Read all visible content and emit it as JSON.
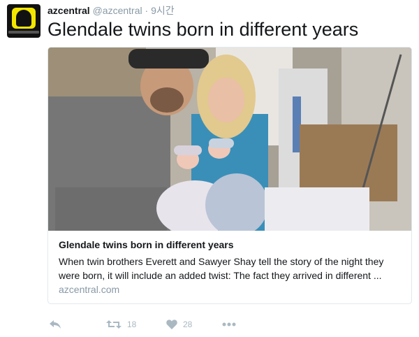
{
  "account": {
    "name": "azcentral",
    "handle": "@azcentral",
    "separator": "·",
    "time": "9시간",
    "avatar_icon": "snapchat-ghost-logo"
  },
  "tweet": {
    "text": "Glendale twins born in different years"
  },
  "card": {
    "image_alt": "Parents holding newborn twins in hospital",
    "title": "Glendale twins born in different years",
    "description": "When twin brothers  Everett and Sawyer Shay tell the story of the night they were born, it will include an added twist: The fact they arrived in different ...",
    "domain": "azcentral.com"
  },
  "actions": {
    "reply_icon": "reply-icon",
    "retweet_icon": "retweet-icon",
    "retweet_count": "18",
    "like_icon": "heart-icon",
    "like_count": "28",
    "more_icon": "more-icon"
  },
  "colors": {
    "text": "#14171a",
    "secondary": "#8899a6",
    "action_gray": "#aab8c2",
    "border": "#e1e8ed",
    "avatar_yellow": "#f2e600"
  }
}
